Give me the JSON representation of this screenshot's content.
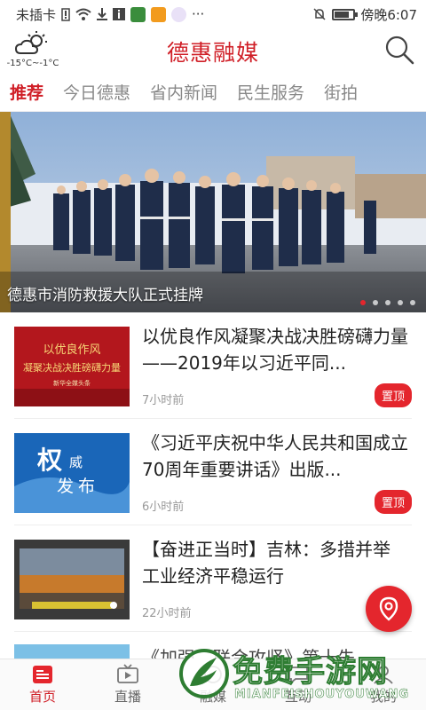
{
  "status_bar": {
    "left_text": "未插卡",
    "right_text": "傍晚6:07",
    "more": "···"
  },
  "header": {
    "title": "德惠融媒",
    "weather_temp": "-15°C~-1°C",
    "weather_icon": "partly-cloudy-icon",
    "search_icon": "search-icon"
  },
  "tabs": [
    {
      "label": "推荐",
      "active": true
    },
    {
      "label": "今日德惠"
    },
    {
      "label": "省内新闻"
    },
    {
      "label": "民生服务"
    },
    {
      "label": "街拍"
    }
  ],
  "banner": {
    "caption": "德惠市消防救援大队正式挂牌",
    "slides": 5,
    "active_slide": 1
  },
  "news": [
    {
      "title": "以优良作风凝聚决战决胜磅礴力量——2019年以习近平同...",
      "time": "7小时前",
      "badge": "置顶",
      "thumb_lines": [
        "以优良作风",
        "凝聚决战决胜磅礴力量",
        "新华全媒头条"
      ]
    },
    {
      "title": "《习近平庆祝中华人民共和国成立70周年重要讲话》出版...",
      "time": "6小时前",
      "badge": "置顶",
      "thumb_lines": [
        "权",
        "威",
        "发",
        "布"
      ]
    },
    {
      "title": "【奋进正当时】吉林：多措并举 工业经济平稳运行",
      "time": "22小时前",
      "badge": ""
    }
  ],
  "partial_news": {
    "title": "《加强…联合攻坚》第十先..."
  },
  "bottom_nav": [
    {
      "label": "首页",
      "icon": "home-news-icon",
      "active": true
    },
    {
      "label": "直播",
      "icon": "live-tv-icon"
    },
    {
      "label": "融媒",
      "icon": "media-icon"
    },
    {
      "label": "互动",
      "icon": "interact-icon"
    },
    {
      "label": "我的",
      "icon": "profile-icon"
    }
  ],
  "watermark": {
    "text": "免费手游网",
    "sub": "MIANFEISHOUYOUWANG"
  },
  "colors": {
    "brand_red": "#d01f27",
    "badge_red": "#e4262d"
  }
}
